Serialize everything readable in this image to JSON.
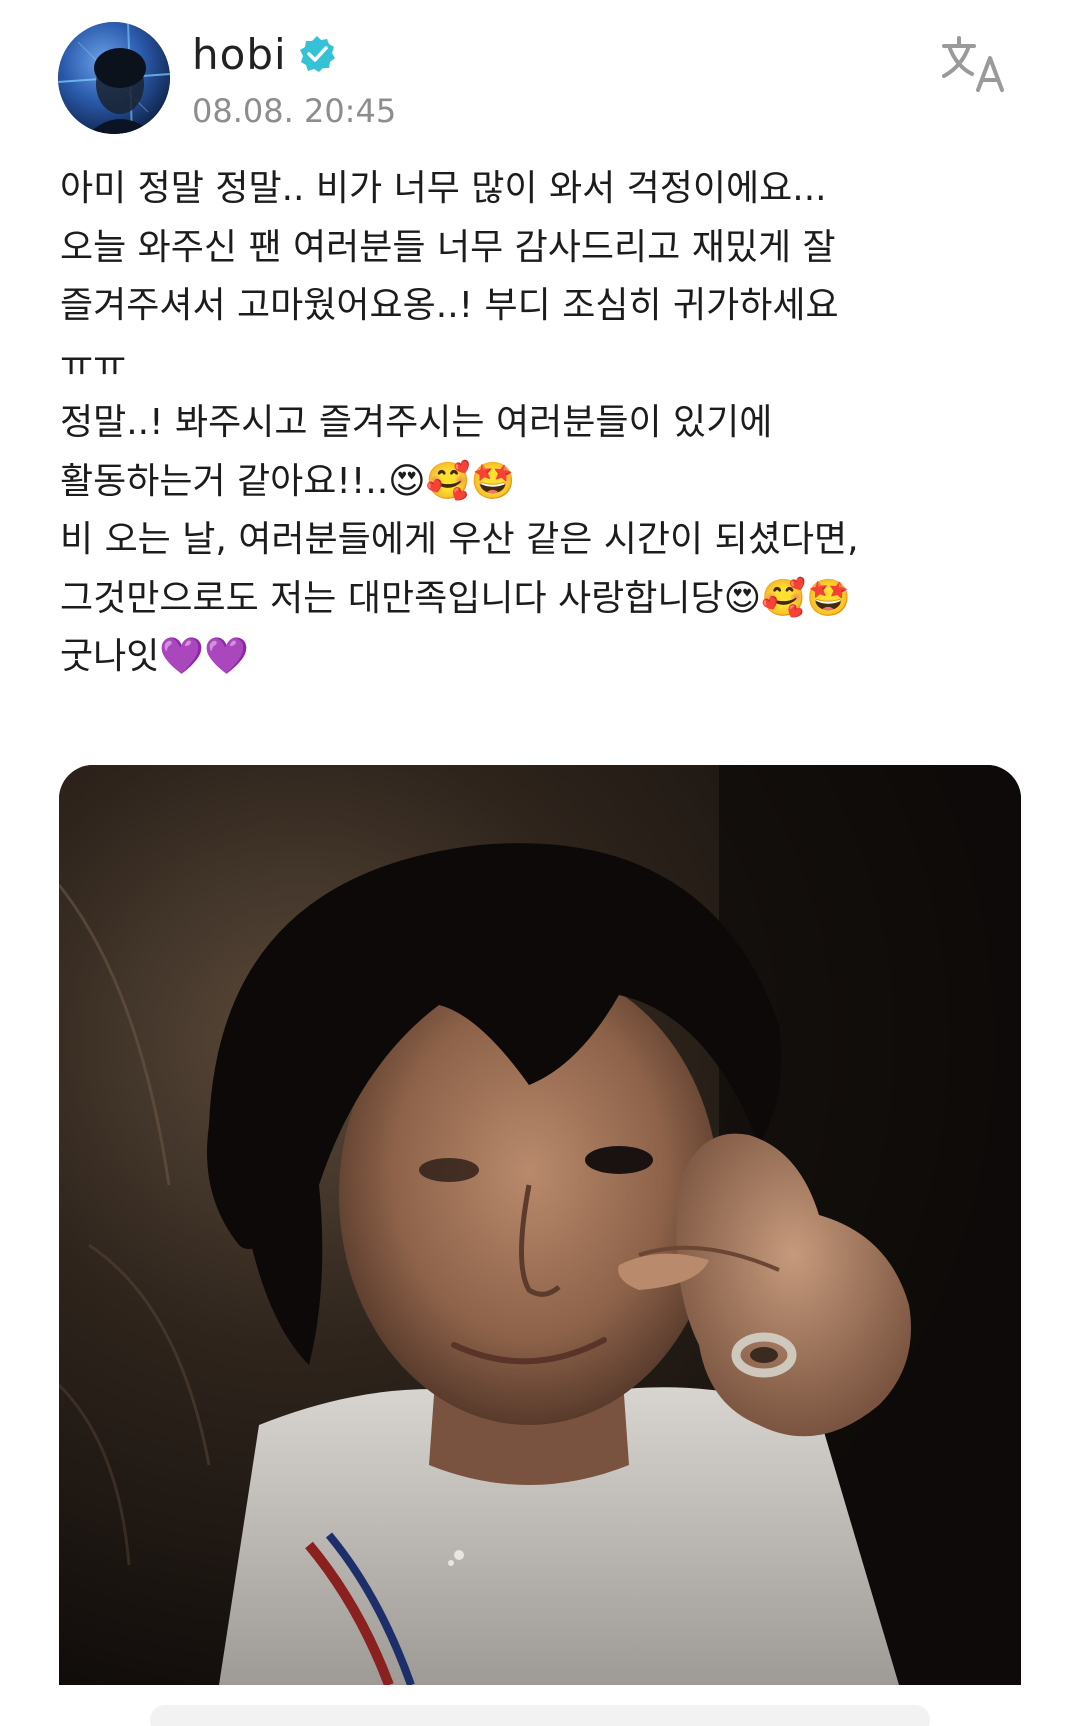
{
  "post": {
    "author": {
      "name": "hobi",
      "verified": true,
      "verified_color": "#35c2d6",
      "avatar_icon": "profile-photo"
    },
    "timestamp": "08.08. 20:45",
    "translate_icon": "translate-icon",
    "body_lines": [
      "아미 정말 정말.. 비가 너무 많이 와서 걱정이에요...",
      "오늘 와주신 팬 여러분들 너무 감사드리고 재밌게 잘",
      "즐겨주셔서 고마웠어요옹..! 부디 조심히 귀가하세요",
      "ㅠㅠ",
      "정말..! 봐주시고 즐겨주시는 여러분들이 있기에",
      "활동하는거 같아요!!..😍🥰🤩",
      "비 오는 날, 여러분들에게 우산 같은 시간이 되셨다면,",
      "그것만으로도 저는 대만족입니다 사랑합니당😍🥰🤩",
      "굿나잇💜💜"
    ],
    "photo": {
      "description_icon": "selfie-photo"
    }
  },
  "colors": {
    "text": "#1c1c1c",
    "timestamp": "#8d8d8d",
    "icon_gray": "#9a9a9a"
  }
}
